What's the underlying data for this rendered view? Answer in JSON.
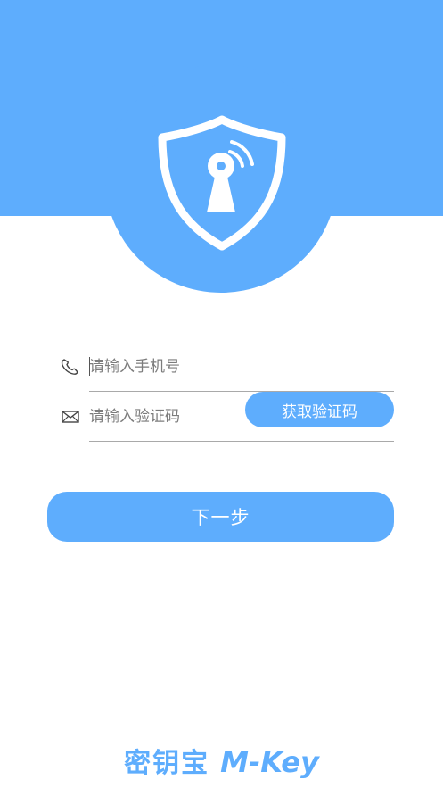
{
  "header": {
    "logo_icon": "shield-keyhole-signal-icon",
    "accent_color": "#5eadfd"
  },
  "form": {
    "phone": {
      "icon": "phone-icon",
      "placeholder": "请输入手机号",
      "value": ""
    },
    "code": {
      "icon": "mail-icon",
      "placeholder": "请输入验证码",
      "value": "",
      "button_label": "获取验证码"
    }
  },
  "next_button_label": "下一步",
  "brand": {
    "name_cn": "密钥宝",
    "name_en": "M-Key"
  }
}
